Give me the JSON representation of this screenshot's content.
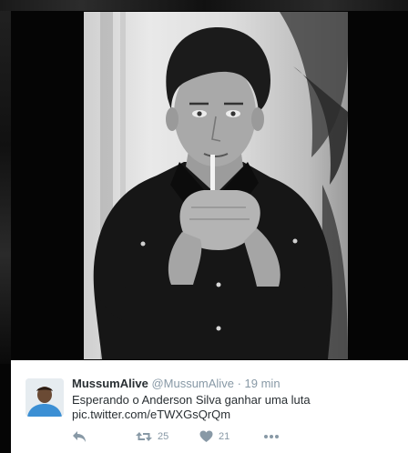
{
  "tweet": {
    "display_name": "MussumAlive",
    "handle": "@MussumAlive",
    "separator": "·",
    "time": "19 min",
    "text": "Esperando o Anderson Silva ganhar uma luta",
    "link": "pic.twitter.com/eTWXGsQrQm",
    "actions": {
      "retweet_count": "25",
      "like_count": "21"
    }
  },
  "icons": {
    "reply": "reply-icon",
    "retweet": "retweet-icon",
    "like": "heart-icon",
    "more": "more-dots-icon"
  },
  "colors": {
    "name": "#292f33",
    "meta": "#8899a6",
    "card_background": "#ffffff",
    "page_background": "#000000"
  }
}
